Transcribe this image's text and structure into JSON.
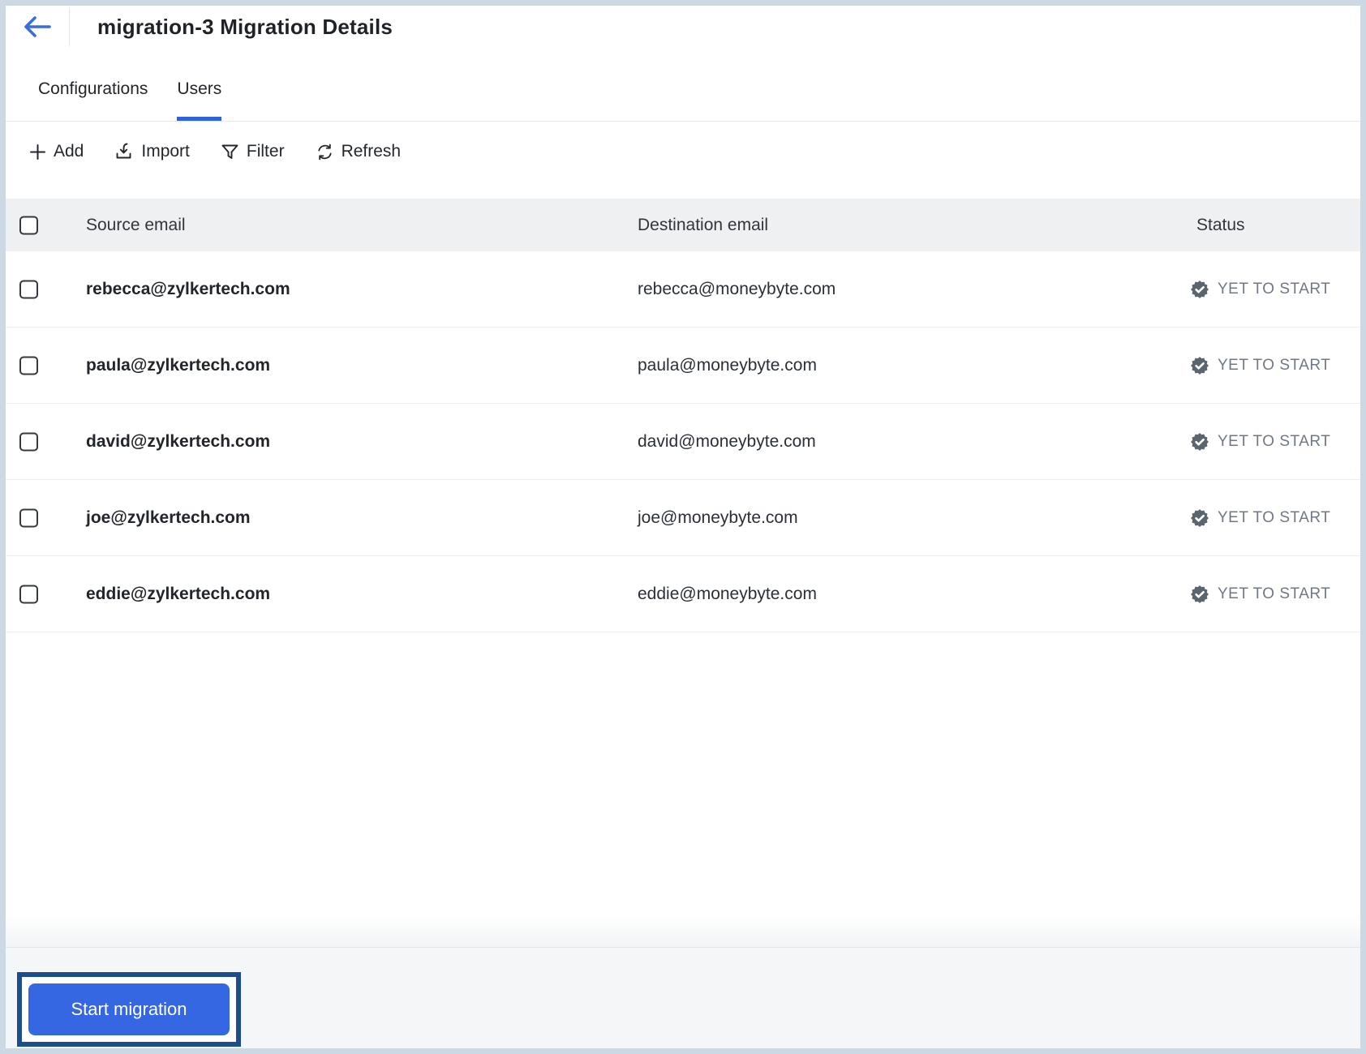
{
  "header": {
    "title": "migration-3 Migration Details"
  },
  "tabs": [
    {
      "label": "Configurations",
      "active": false
    },
    {
      "label": "Users",
      "active": true
    }
  ],
  "toolbar": {
    "add_label": "Add",
    "import_label": "Import",
    "filter_label": "Filter",
    "refresh_label": "Refresh"
  },
  "table": {
    "columns": {
      "source": "Source email",
      "destination": "Destination email",
      "status": "Status"
    },
    "rows": [
      {
        "source": "rebecca@zylkertech.com",
        "destination": "rebecca@moneybyte.com",
        "status": "YET TO START"
      },
      {
        "source": "paula@zylkertech.com",
        "destination": "paula@moneybyte.com",
        "status": "YET TO START"
      },
      {
        "source": "david@zylkertech.com",
        "destination": "david@moneybyte.com",
        "status": "YET TO START"
      },
      {
        "source": "joe@zylkertech.com",
        "destination": "joe@moneybyte.com",
        "status": "YET TO START"
      },
      {
        "source": "eddie@zylkertech.com",
        "destination": "eddie@moneybyte.com",
        "status": "YET TO START"
      }
    ]
  },
  "footer": {
    "start_button": "Start migration"
  },
  "colors": {
    "accent_blue": "#3667e2",
    "annotation_border": "#1d4e8c",
    "tab_underline": "#2f62d9",
    "status_text": "#6f7884",
    "status_icon": "#5b6570",
    "table_header_bg": "#eef0f2",
    "footer_bg": "#f4f6f8"
  }
}
